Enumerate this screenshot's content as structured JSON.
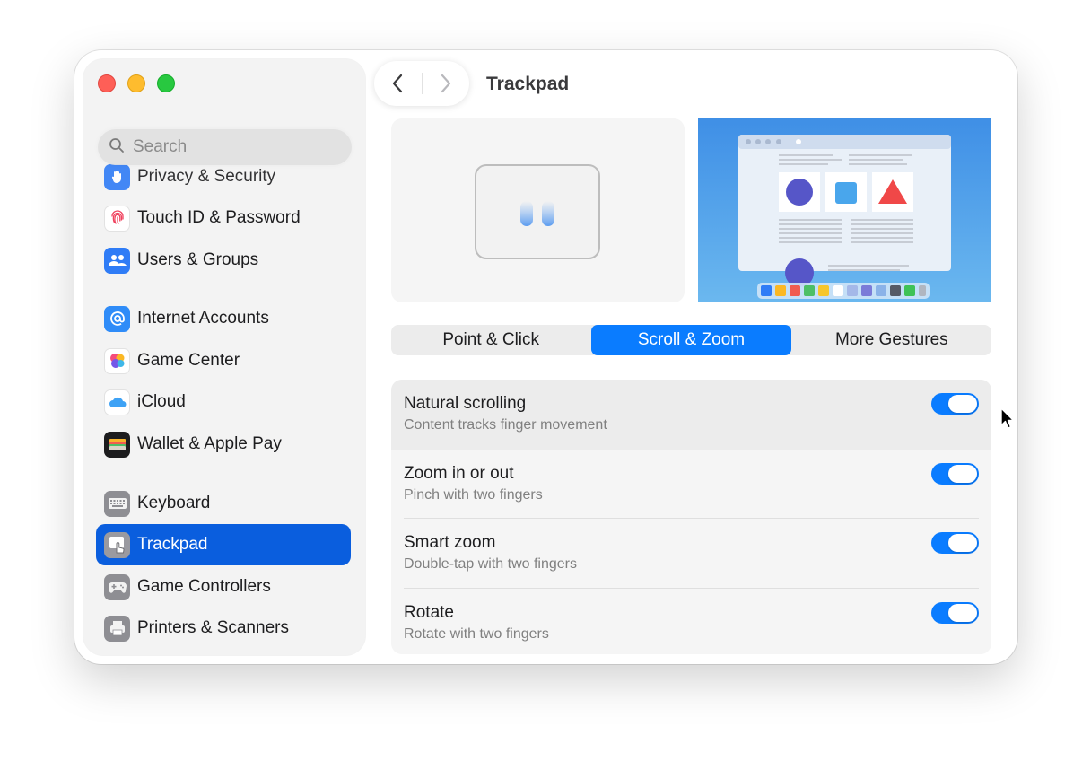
{
  "window": {
    "title": "Trackpad"
  },
  "search": {
    "placeholder": "Search"
  },
  "sidebar": {
    "items": [
      {
        "label": "Privacy & Security",
        "icon": "hand-icon"
      },
      {
        "label": "Touch ID & Password",
        "icon": "fingerprint-icon"
      },
      {
        "label": "Users & Groups",
        "icon": "users-icon"
      },
      {
        "label": "Internet Accounts",
        "icon": "at-icon"
      },
      {
        "label": "Game Center",
        "icon": "game-center-icon"
      },
      {
        "label": "iCloud",
        "icon": "cloud-icon"
      },
      {
        "label": "Wallet & Apple Pay",
        "icon": "wallet-icon"
      },
      {
        "label": "Keyboard",
        "icon": "keyboard-icon"
      },
      {
        "label": "Trackpad",
        "icon": "trackpad-icon",
        "selected": true
      },
      {
        "label": "Game Controllers",
        "icon": "gamepad-icon"
      },
      {
        "label": "Printers & Scanners",
        "icon": "printer-icon"
      }
    ]
  },
  "tabs": [
    {
      "label": "Point & Click"
    },
    {
      "label": "Scroll & Zoom",
      "active": true
    },
    {
      "label": "More Gestures"
    }
  ],
  "settings": [
    {
      "title": "Natural scrolling",
      "subtitle": "Content tracks finger movement",
      "enabled": true
    },
    {
      "title": "Zoom in or out",
      "subtitle": "Pinch with two fingers",
      "enabled": true
    },
    {
      "title": "Smart zoom",
      "subtitle": "Double-tap with two fingers",
      "enabled": true
    },
    {
      "title": "Rotate",
      "subtitle": "Rotate with two fingers",
      "enabled": true
    }
  ],
  "colors": {
    "accent": "#0a7cff",
    "sidebar_selected": "#0a5ede"
  }
}
